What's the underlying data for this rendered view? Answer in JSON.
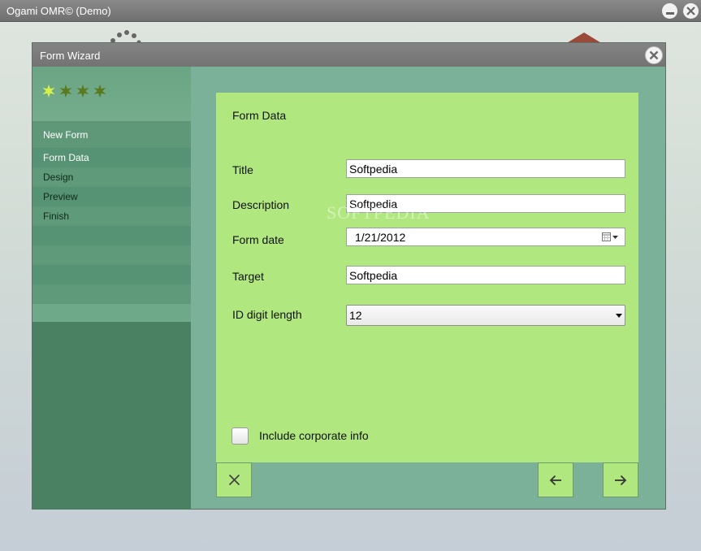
{
  "app": {
    "title": "Ogami OMR© (Demo)",
    "minimize_icon": "minimize-icon",
    "close_icon": "close-icon"
  },
  "dialog": {
    "title": "Form Wizard",
    "close_icon": "close-icon",
    "progress_stars": 4
  },
  "sidebar": {
    "items": [
      {
        "label": "New Form"
      },
      {
        "label": "Form Data"
      },
      {
        "label": "Design"
      },
      {
        "label": "Preview"
      },
      {
        "label": "Finish"
      }
    ]
  },
  "form": {
    "heading": "Form Data",
    "fields": {
      "title": {
        "label": "Title",
        "value": "Softpedia"
      },
      "description": {
        "label": "Description",
        "value": "Softpedia"
      },
      "form_date": {
        "label": "Form date",
        "value": "1/21/2012"
      },
      "target": {
        "label": "Target",
        "value": "Softpedia"
      },
      "id_digit_length": {
        "label": "ID digit length",
        "value": "12"
      }
    },
    "checkbox": {
      "label": "Include corporate info",
      "checked": false
    }
  },
  "watermark": "SOFTPEDIA",
  "nav": {
    "cancel_icon": "cancel-x-icon",
    "back_icon": "arrow-left-icon",
    "next_icon": "arrow-right-icon"
  },
  "colors": {
    "panel": "#b1e77f",
    "sidebar": "#4b8163",
    "dialog_bg": "#7bb198",
    "titlebar": "#7a7a7a"
  }
}
